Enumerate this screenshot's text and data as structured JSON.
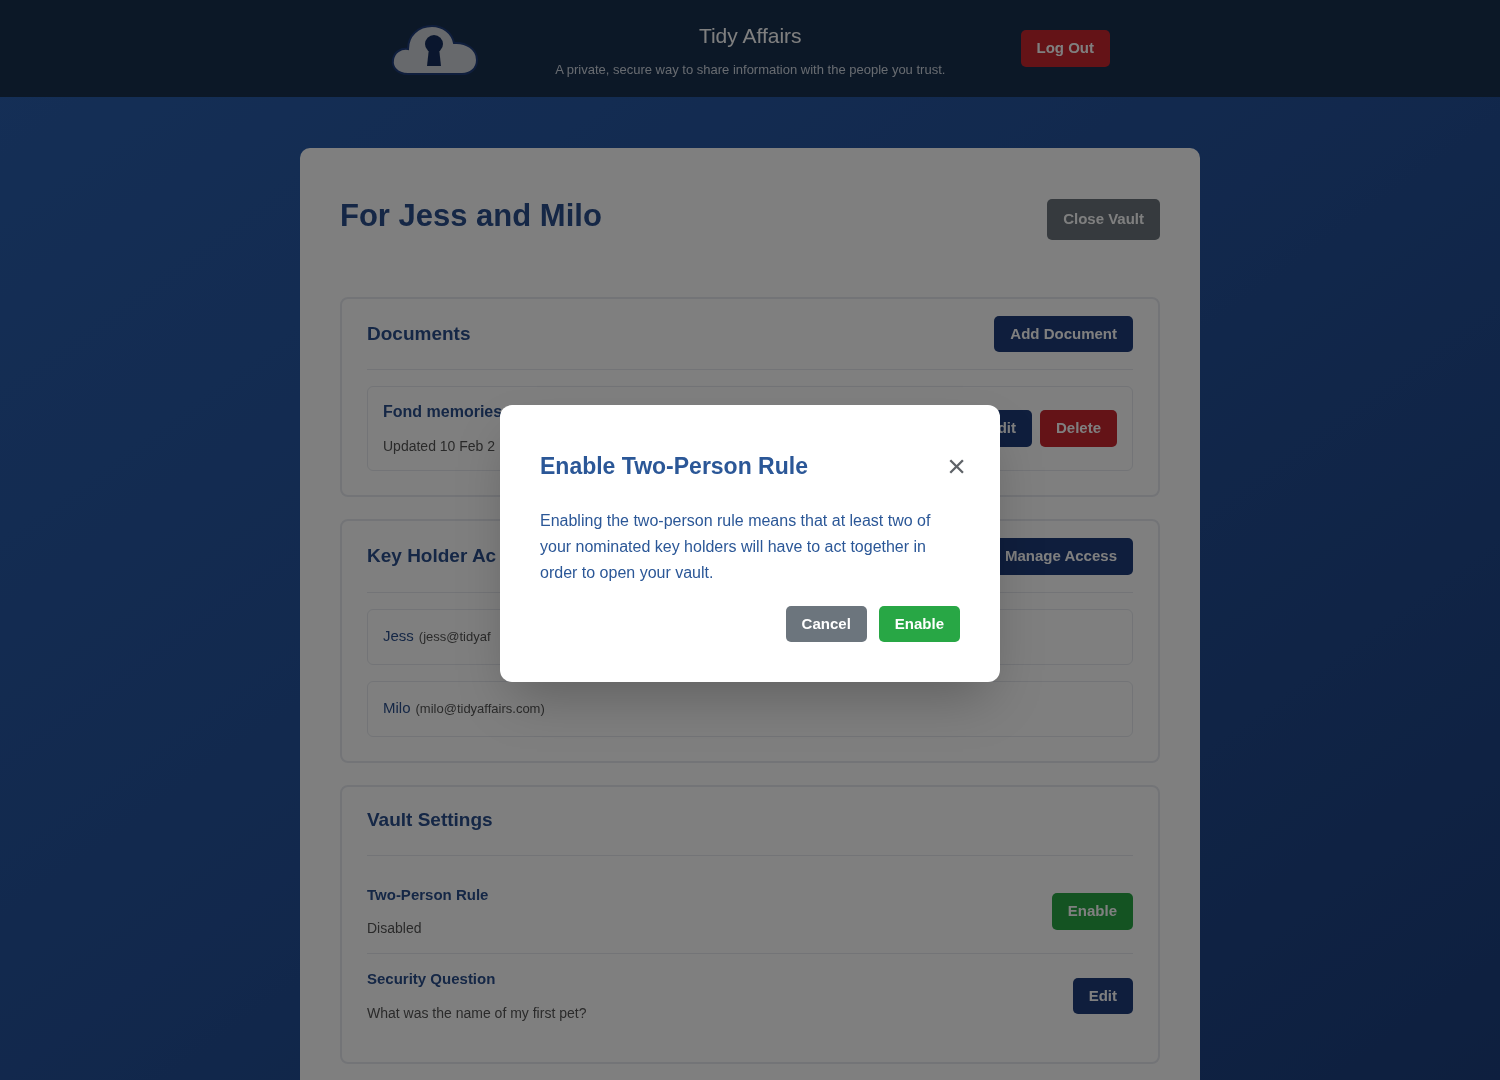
{
  "header": {
    "title": "Tidy Affairs",
    "tagline": "A private, secure way to share information with the people you trust.",
    "logout": {
      "label": "Log Out",
      "kind": "danger"
    }
  },
  "vault": {
    "title": "For Jess and Milo",
    "close": {
      "label": "Close Vault",
      "kind": "secondary"
    }
  },
  "documents": {
    "title": "Documents",
    "action": {
      "label": "Add Document",
      "kind": "primary"
    },
    "items": [
      {
        "name": "Fond memories",
        "updated": "Updated 10 Feb 2",
        "buttons": [
          {
            "label": "dit",
            "kind": "primary"
          },
          {
            "label": "Delete",
            "kind": "danger"
          }
        ]
      }
    ]
  },
  "key_holders": {
    "title": "Key Holder Ac",
    "action": {
      "label": "Manage Access",
      "kind": "primary"
    },
    "holders": [
      {
        "name": "Jess",
        "email": "(jess@tidyaf"
      },
      {
        "name": "Milo",
        "email": "(milo@tidyaffairs.com)"
      }
    ]
  },
  "settings": {
    "title": "Vault Settings",
    "rows": [
      {
        "name": "Two-Person Rule",
        "value": "Disabled",
        "button": {
          "label": "Enable",
          "kind": "success"
        }
      },
      {
        "name": "Security Question",
        "value": "What was the name of my first pet?",
        "button": {
          "label": "Edit",
          "kind": "primary"
        }
      }
    ]
  },
  "modal": {
    "title": "Enable Two-Person Rule",
    "close": "×",
    "body": "Enabling the two-person rule means that at least two of your nominated key holders will have to act together in order to open your vault.",
    "buttons": [
      {
        "label": "Cancel",
        "kind": "secondary"
      },
      {
        "label": "Enable",
        "kind": "success"
      }
    ]
  }
}
